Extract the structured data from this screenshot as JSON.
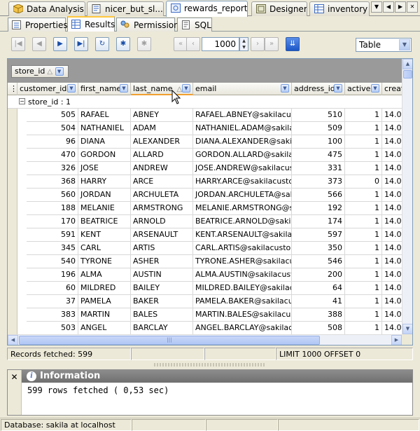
{
  "editor_tabs": [
    {
      "label": "Data Analysis",
      "icon": "cube-icon",
      "active": false
    },
    {
      "label": "nicer_but_sl...",
      "icon": "sql-editor-icon",
      "active": false
    },
    {
      "label": "rewards_report",
      "icon": "routine-icon",
      "active": true
    },
    {
      "label": "Designer",
      "icon": "designer-icon",
      "active": false
    },
    {
      "label": "inventory",
      "icon": "table-icon",
      "active": false
    }
  ],
  "sub_tabs": [
    {
      "label": "Properties",
      "icon": "properties-icon",
      "active": false
    },
    {
      "label": "Results",
      "icon": "results-icon",
      "active": true
    },
    {
      "label": "Permissions",
      "icon": "permissions-icon",
      "active": false
    },
    {
      "label": "SQL",
      "icon": "sql-icon",
      "active": false
    }
  ],
  "toolbar": {
    "limit_value": "1000",
    "view_mode": "Table"
  },
  "group_by": {
    "chip_label": "store_id",
    "row_label": "store_id : 1"
  },
  "columns": [
    {
      "key": "customer_id",
      "label": "customer_id"
    },
    {
      "key": "first_name",
      "label": "first_name"
    },
    {
      "key": "last_name",
      "label": "last_name",
      "sorted": true
    },
    {
      "key": "email",
      "label": "email"
    },
    {
      "key": "address_id",
      "label": "address_id"
    },
    {
      "key": "active",
      "label": "active"
    },
    {
      "key": "create_date",
      "label": "creat"
    }
  ],
  "rows": [
    [
      "505",
      "RAFAEL",
      "ABNEY",
      "RAFAEL.ABNEY@sakilacusto",
      "510",
      "1",
      "14.0"
    ],
    [
      "504",
      "NATHANIEL",
      "ADAM",
      "NATHANIEL.ADAM@sakilacus",
      "509",
      "1",
      "14.0"
    ],
    [
      "96",
      "DIANA",
      "ALEXANDER",
      "DIANA.ALEXANDER@sakilacu",
      "100",
      "1",
      "14.0"
    ],
    [
      "470",
      "GORDON",
      "ALLARD",
      "GORDON.ALLARD@sakilacust",
      "475",
      "1",
      "14.0"
    ],
    [
      "326",
      "JOSE",
      "ANDREW",
      "JOSE.ANDREW@sakilacustor",
      "331",
      "1",
      "14.0"
    ],
    [
      "368",
      "HARRY",
      "ARCE",
      "HARRY.ARCE@sakilacustome",
      "373",
      "0",
      "14.0"
    ],
    [
      "560",
      "JORDAN",
      "ARCHULETA",
      "JORDAN.ARCHULETA@sakila",
      "566",
      "1",
      "14.0"
    ],
    [
      "188",
      "MELANIE",
      "ARMSTRONG",
      "MELANIE.ARMSTRONG@saki",
      "192",
      "1",
      "14.0"
    ],
    [
      "170",
      "BEATRICE",
      "ARNOLD",
      "BEATRICE.ARNOLD@sakilacu",
      "174",
      "1",
      "14.0"
    ],
    [
      "591",
      "KENT",
      "ARSENAULT",
      "KENT.ARSENAULT@sakilacus",
      "597",
      "1",
      "14.0"
    ],
    [
      "345",
      "CARL",
      "ARTIS",
      "CARL.ARTIS@sakilacustomer",
      "350",
      "1",
      "14.0"
    ],
    [
      "540",
      "TYRONE",
      "ASHER",
      "TYRONE.ASHER@sakilacusto",
      "546",
      "1",
      "14.0"
    ],
    [
      "196",
      "ALMA",
      "AUSTIN",
      "ALMA.AUSTIN@sakilacustom",
      "200",
      "1",
      "14.0"
    ],
    [
      "60",
      "MILDRED",
      "BAILEY",
      "MILDRED.BAILEY@sakilacust",
      "64",
      "1",
      "14.0"
    ],
    [
      "37",
      "PAMELA",
      "BAKER",
      "PAMELA.BAKER@sakilacusto",
      "41",
      "1",
      "14.0"
    ],
    [
      "383",
      "MARTIN",
      "BALES",
      "MARTIN.BALES@sakilacustor",
      "388",
      "1",
      "14.0"
    ],
    [
      "503",
      "ANGEL",
      "BARCLAY",
      "ANGEL.BARCLAY@sakilacust",
      "508",
      "1",
      "14.0"
    ]
  ],
  "grid_status": {
    "records": "Records fetched: 599",
    "limit": "LIMIT 1000 OFFSET 0"
  },
  "info_panel": {
    "title": "Information",
    "message": "599 rows fetched ( 0,53 sec)"
  },
  "app_status": {
    "database": "Database: sakila at localhost"
  }
}
